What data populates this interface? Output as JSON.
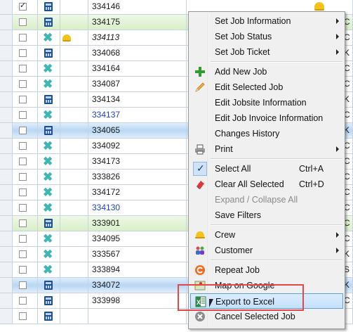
{
  "grid": {
    "rows": [
      {
        "job": "334146",
        "checked": true,
        "icon": "calculator",
        "style": "white",
        "edge": ""
      },
      {
        "job": "334175",
        "checked": false,
        "icon": "calculator",
        "style": "green",
        "edge": "C"
      },
      {
        "job": "334113",
        "checked": false,
        "icon": "x",
        "hat": true,
        "style": "white",
        "edge": "C",
        "italic": true
      },
      {
        "job": "334068",
        "checked": false,
        "icon": "calculator",
        "style": "white",
        "edge": "K"
      },
      {
        "job": "334164",
        "checked": false,
        "icon": "x",
        "style": "white",
        "edge": "C"
      },
      {
        "job": "334087",
        "checked": false,
        "icon": "x",
        "style": "white",
        "edge": "C"
      },
      {
        "job": "334134",
        "checked": false,
        "icon": "calculator",
        "style": "white",
        "edge": "K"
      },
      {
        "job": "334137",
        "checked": false,
        "icon": "x",
        "style": "white",
        "edge": "C",
        "link": true
      },
      {
        "job": "334065",
        "checked": false,
        "icon": "calculator",
        "style": "blue",
        "edge": "K"
      },
      {
        "job": "334092",
        "checked": false,
        "icon": "x",
        "style": "white",
        "edge": "C"
      },
      {
        "job": "334173",
        "checked": false,
        "icon": "x",
        "style": "white",
        "edge": "C"
      },
      {
        "job": "333826",
        "checked": false,
        "icon": "x",
        "style": "white",
        "edge": "C"
      },
      {
        "job": "334172",
        "checked": false,
        "icon": "x",
        "style": "white",
        "edge": "C"
      },
      {
        "job": "334130",
        "checked": false,
        "icon": "x",
        "style": "white",
        "edge": "C",
        "link": true
      },
      {
        "job": "333901",
        "checked": false,
        "icon": "calculator",
        "style": "green",
        "edge": "C"
      },
      {
        "job": "334095",
        "checked": false,
        "icon": "x",
        "style": "white",
        "edge": "C"
      },
      {
        "job": "333567",
        "checked": false,
        "icon": "x",
        "style": "white",
        "edge": "K"
      },
      {
        "job": "333894",
        "checked": false,
        "icon": "x",
        "style": "white",
        "edge": "S"
      },
      {
        "job": "334072",
        "checked": false,
        "icon": "calculator",
        "style": "blue",
        "edge": "K"
      },
      {
        "job": "333998",
        "checked": false,
        "icon": "calculator",
        "style": "white",
        "edge": "C"
      },
      {
        "job": "",
        "checked": false,
        "icon": "calculator",
        "style": "white",
        "edge": ""
      }
    ]
  },
  "menu": {
    "items": [
      {
        "label": "Set Job Information",
        "submenu": true
      },
      {
        "label": "Set Job Status",
        "submenu": true
      },
      {
        "label": "Set Job Ticket",
        "submenu": true
      },
      {
        "sep": true
      },
      {
        "label": "Add New Job",
        "icon": "plus-icon"
      },
      {
        "label": "Edit Selected Job",
        "icon": "pencil-icon"
      },
      {
        "label": "Edit Jobsite Information"
      },
      {
        "label": "Edit Job Invoice Information"
      },
      {
        "label": "Changes History"
      },
      {
        "label": "Print",
        "icon": "printer-icon",
        "submenu": true
      },
      {
        "sep": true
      },
      {
        "label": "Select All",
        "shortcut": "Ctrl+A",
        "icon": "checkmark-icon"
      },
      {
        "label": "Clear All Selected",
        "shortcut": "Ctrl+D",
        "icon": "eraser-icon"
      },
      {
        "label": "Expand / Collapse All",
        "disabled": true
      },
      {
        "label": "Save Filters"
      },
      {
        "sep": true
      },
      {
        "label": "Crew",
        "icon": "hardhat-icon",
        "submenu": true
      },
      {
        "label": "Customer",
        "icon": "people-icon",
        "submenu": true
      },
      {
        "sep": true
      },
      {
        "label": "Repeat Job",
        "icon": "repeat-icon"
      },
      {
        "label": "Map on Google",
        "icon": "map-icon"
      },
      {
        "label": "Export to Excel",
        "icon": "excel-icon",
        "highlighted": true
      },
      {
        "label": "Cancel Selected Job",
        "icon": "cancel-icon"
      }
    ]
  },
  "colors": {
    "highlight_border": "#5d9fdb",
    "annotation": "#e14848",
    "row_green": "#d9efc9",
    "row_blue": "#b9d6f3"
  }
}
